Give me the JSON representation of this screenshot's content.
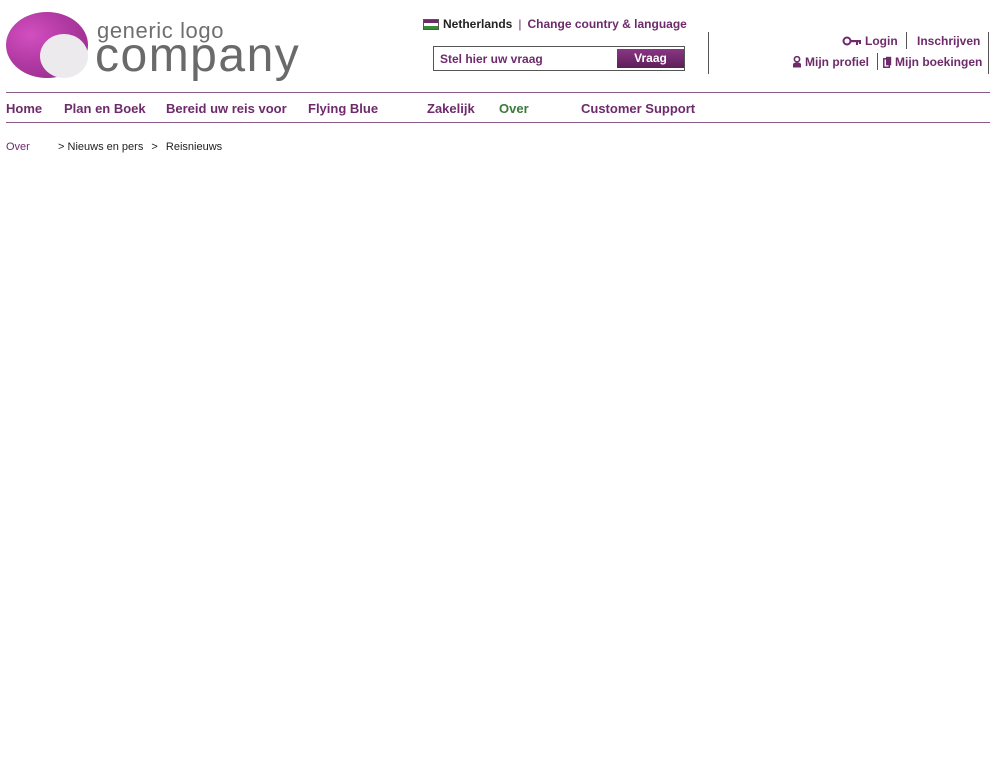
{
  "logo": {
    "line1": "generic logo",
    "line2": "company"
  },
  "header": {
    "country": "Netherlands",
    "separator": "|",
    "change_link": "Change country & language",
    "search_placeholder": "Stel hier uw vraag",
    "search_button": "Vraag"
  },
  "account": {
    "login": "Login",
    "register": "Inschrijven",
    "profile": "Mijn profiel",
    "bookings": "Mijn boekingen"
  },
  "nav": {
    "items": [
      "Home",
      "Plan en Boek",
      "Bereid uw reis voor",
      "Flying Blue",
      "Zakelijk",
      "Over",
      "Customer Support"
    ],
    "active": "Over"
  },
  "breadcrumb": {
    "items": [
      "Over",
      "Nieuws en pers",
      "Reisnieuws"
    ],
    "separator": ">"
  },
  "colors": {
    "brand": "#6e2a6b",
    "active_nav": "#3a7a3a",
    "logo_magenta": "#b23aa3",
    "logo_grey": "#6a6a6a"
  },
  "icons": [
    "key-icon",
    "profile-icon",
    "bookings-icon",
    "flag-icon"
  ]
}
